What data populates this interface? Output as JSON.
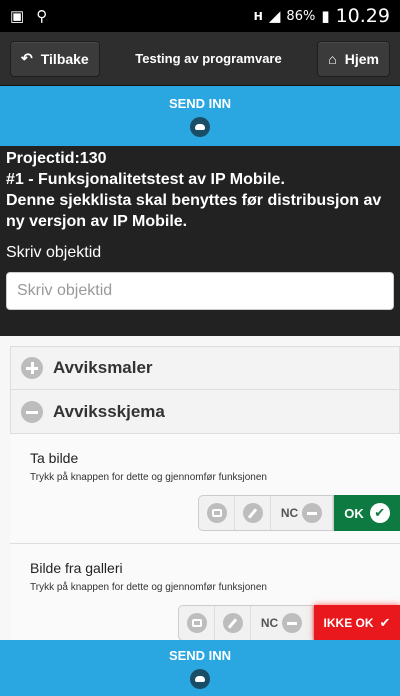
{
  "status_bar": {
    "battery_percent": "86%",
    "time": "10.29",
    "network": "H"
  },
  "nav": {
    "back_label": "Tilbake",
    "title": "Testing av programvare",
    "home_label": "Hjem"
  },
  "send_button": {
    "label": "SEND INN"
  },
  "project": {
    "id_line": "Projectid:130",
    "title_line": "#1 - Funksjonalitetstest av IP Mobile.",
    "description": "Denne sjekklista skal benyttes før distribusjon av ny versjon av IP Mobile.",
    "objekt_label": "Skriv objektid",
    "objekt_placeholder": "Skriv objektid"
  },
  "sections": [
    {
      "label": "Avviksmaler",
      "expanded": false
    },
    {
      "label": "Avviksskjema",
      "expanded": true
    }
  ],
  "items": [
    {
      "title": "Ta bilde",
      "description": "Trykk på knappen for dette og gjennomfør funksjonen",
      "nc_label": "NC",
      "result_label": "OK"
    },
    {
      "title": "Bilde fra galleri",
      "description": "Trykk på knappen for dette og gjennomfør funksjonen",
      "nc_label": "NC",
      "result_label": "IKKE OK"
    }
  ],
  "colors": {
    "accent_blue": "#2aa7e0",
    "ok_green": "#0d7a41",
    "fail_red": "#e8181d"
  }
}
